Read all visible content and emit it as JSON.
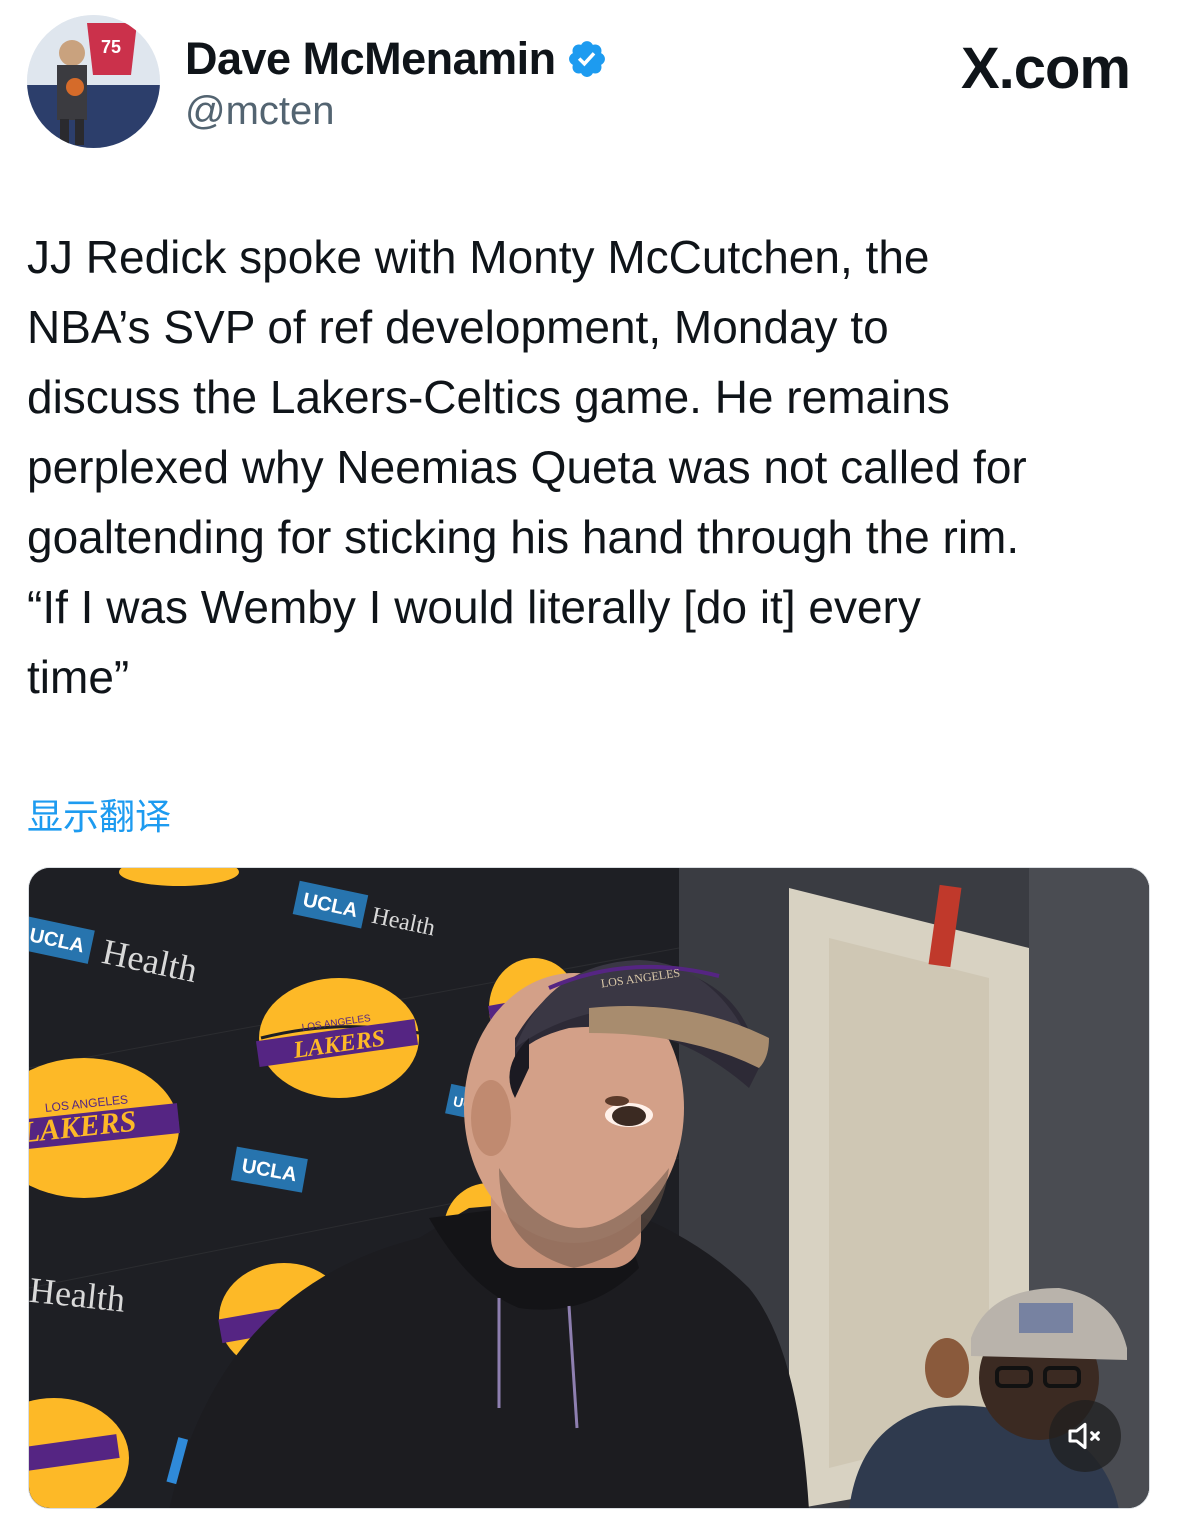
{
  "author": {
    "display_name": "Dave McMenamin",
    "handle": "@mcten",
    "verified": true,
    "avatar_badge": "75"
  },
  "brand": "X.com",
  "tweet": {
    "lines": [
      "JJ Redick spoke with Monty McCutchen, the",
      "NBA’s SVP of ref development, Monday to",
      "discuss the Lakers-Celtics game. He remains",
      "perplexed why Neemias Queta was not called for",
      "goaltending for sticking his hand through the rim.",
      "“If I was Wemby I would literally [do it] every",
      "time”"
    ]
  },
  "translate_label": "显示翻译",
  "media": {
    "backdrop_text": {
      "ucla": "UCLA",
      "health": "Health",
      "lakers": "LAKERS",
      "los_angeles": "LOS ANGELES"
    },
    "mute_icon": "speaker-muted-icon"
  },
  "colors": {
    "accent": "#1d9bf0",
    "text": "#0f1419",
    "secondary": "#536471",
    "lakers_purple": "#552583",
    "lakers_gold": "#fdb927"
  }
}
